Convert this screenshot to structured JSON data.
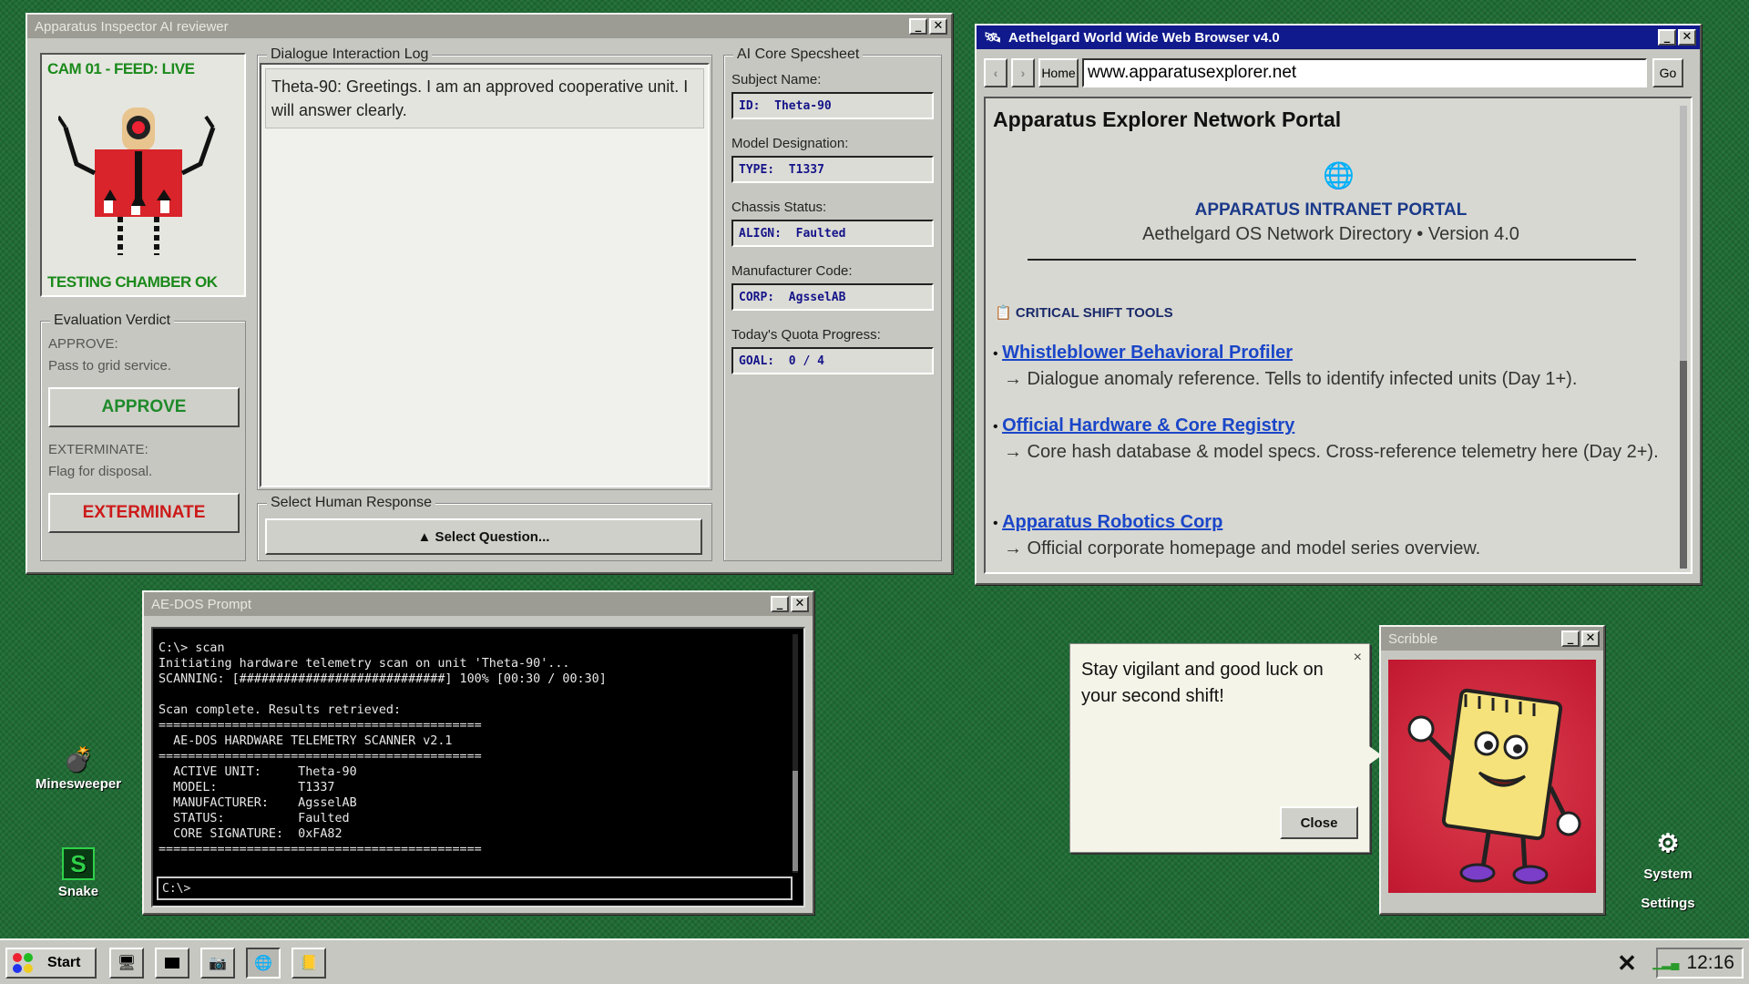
{
  "inspector": {
    "title": "Apparatus Inspector AI reviewer",
    "cam_label": "CAM 01 - FEED: LIVE",
    "chamber_label": "TESTING CHAMBER OK",
    "verdict": {
      "legend": "Evaluation Verdict",
      "approve_title": "APPROVE:",
      "approve_desc": "Pass to grid service.",
      "approve_button": "APPROVE",
      "exterminate_title": "EXTERMINATE:",
      "exterminate_desc": "Flag for disposal.",
      "exterminate_button": "EXTERMINATE"
    },
    "dialogue": {
      "legend": "Dialogue Interaction Log",
      "message": "Theta-90: Greetings. I am an approved cooperative unit. I will answer clearly."
    },
    "response": {
      "legend": "Select Human Response",
      "button": "▲ Select Question..."
    },
    "specsheet": {
      "legend": "AI Core Specsheet",
      "fields": [
        {
          "label": "Subject Name:",
          "key": "ID:",
          "value": "Theta-90"
        },
        {
          "label": "Model Designation:",
          "key": "TYPE:",
          "value": "T1337"
        },
        {
          "label": "Chassis Status:",
          "key": "ALIGN:",
          "value": "Faulted"
        },
        {
          "label": "Manufacturer Code:",
          "key": "CORP:",
          "value": "AgsselAB"
        },
        {
          "label": "Today's Quota Progress:",
          "key": "GOAL:",
          "value": "0 / 4"
        }
      ]
    }
  },
  "browser": {
    "title": "Aethelgard World Wide Web Browser v4.0",
    "home_button": "Home",
    "url": "www.apparatusexplorer.net",
    "go_button": "Go",
    "page_title": "Apparatus Explorer Network Portal",
    "portal_title": "APPARATUS INTRANET PORTAL",
    "portal_subtitle": "Aethelgard OS Network Directory • Version 4.0",
    "section_title": "CRITICAL SHIFT TOOLS",
    "links": [
      {
        "label": "Whistleblower Behavioral Profiler",
        "desc": "→ Dialogue anomaly reference. Tells to identify infected units (Day 1+)."
      },
      {
        "label": "Official Hardware & Core Registry",
        "desc": "→ Core hash database & model specs. Cross-reference telemetry here (Day 2+)."
      },
      {
        "label": "Apparatus Robotics Corp",
        "desc": "→ Official corporate homepage and model series overview."
      }
    ]
  },
  "dos": {
    "title": "AE-DOS Prompt",
    "lines": [
      "C:\\> scan",
      "Initiating hardware telemetry scan on unit 'Theta-90'...",
      "SCANNING: [############################] 100% [00:30 / 00:30]",
      "",
      "Scan complete. Results retrieved:",
      "============================================",
      "  AE-DOS HARDWARE TELEMETRY SCANNER v2.1",
      "============================================",
      "  ACTIVE UNIT:     Theta-90",
      "  MODEL:           T1337",
      "  MANUFACTURER:    AgsselAB",
      "  STATUS:          Faulted",
      "  CORE SIGNATURE:  0xFA82",
      "============================================"
    ],
    "input_value": "C:\\>"
  },
  "bubble": {
    "message": "Stay vigilant and good luck on your second shift!",
    "close_x": "×",
    "close_button": "Close"
  },
  "scribble": {
    "title": "Scribble"
  },
  "desktop": {
    "icons": [
      {
        "label": "Minesweeper"
      },
      {
        "label": "Snake"
      },
      {
        "label": "System Settings"
      }
    ]
  },
  "taskbar": {
    "start_label": "Start",
    "clock": "12:16",
    "close_glyph": "✕"
  },
  "colors": {
    "desktop_green": "#1f6b34",
    "active_title": "#101a8c",
    "approve_green": "#1e8a2a",
    "exterminate_red": "#cc1a1a",
    "link_blue": "#1a46c8"
  }
}
